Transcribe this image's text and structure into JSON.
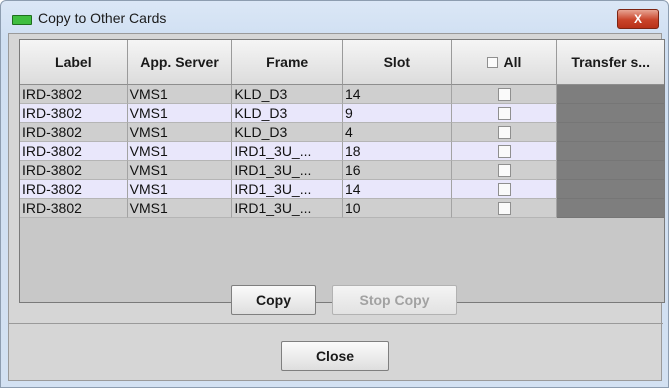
{
  "window": {
    "title": "Copy to Other Cards",
    "close_label": "X"
  },
  "table": {
    "headers": {
      "label": "Label",
      "app_server": "App. Server",
      "frame": "Frame",
      "slot": "Slot",
      "all": "All",
      "transfer": "Transfer s..."
    },
    "rows": [
      {
        "label": "IRD-3802",
        "app_server": "VMS1",
        "frame": "KLD_D3",
        "slot": "14"
      },
      {
        "label": "IRD-3802",
        "app_server": "VMS1",
        "frame": "KLD_D3",
        "slot": "9"
      },
      {
        "label": "IRD-3802",
        "app_server": "VMS1",
        "frame": "KLD_D3",
        "slot": "4"
      },
      {
        "label": "IRD-3802",
        "app_server": "VMS1",
        "frame": "IRD1_3U_...",
        "slot": "18"
      },
      {
        "label": "IRD-3802",
        "app_server": "VMS1",
        "frame": "IRD1_3U_...",
        "slot": "16"
      },
      {
        "label": "IRD-3802",
        "app_server": "VMS1",
        "frame": "IRD1_3U_...",
        "slot": "14"
      },
      {
        "label": "IRD-3802",
        "app_server": "VMS1",
        "frame": "IRD1_3U_...",
        "slot": "10"
      }
    ]
  },
  "buttons": {
    "copy": "Copy",
    "stop_copy": "Stop Copy",
    "close": "Close"
  },
  "colors": {
    "title_icon": "#3fbe3f",
    "close_button": "#c9442a",
    "row_alt": "#e9e7fb",
    "transfer_cell": "#7e7e7e"
  }
}
